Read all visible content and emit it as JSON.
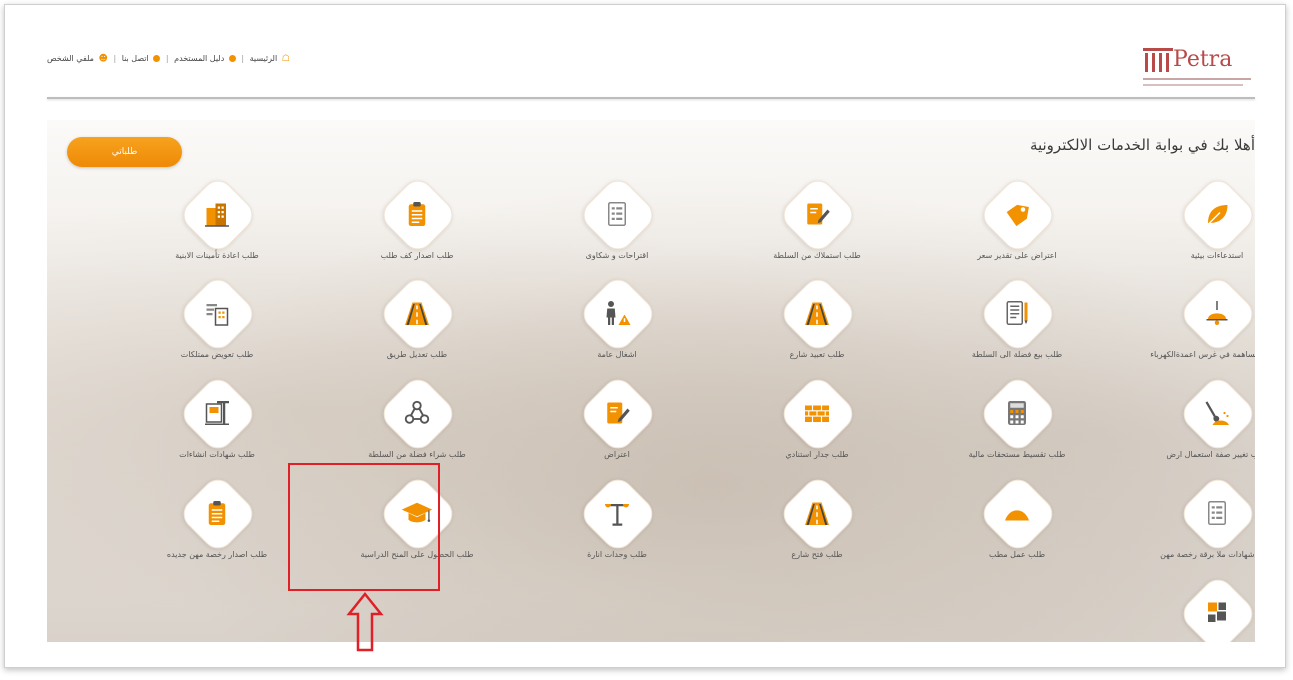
{
  "header": {
    "links": [
      {
        "label": "الرئيسية",
        "icon": "home-icon"
      },
      {
        "label": "دليل المستخدم",
        "icon": "info-icon"
      },
      {
        "label": "اتصل بنا",
        "icon": "info-icon"
      },
      {
        "label": "ملفي الشخص",
        "icon": "user-icon"
      }
    ],
    "logo_text": "Petra"
  },
  "main": {
    "welcome": "أهلا بك في بوابة الخدمات الالكترونية",
    "my_requests_button": "طلباتي"
  },
  "services": [
    {
      "label": "استدعاءات بيئية",
      "icon": "leaf-icon"
    },
    {
      "label": "اعتراض على تقدير سعر",
      "icon": "price-tag-icon"
    },
    {
      "label": "طلب استملاك من السلطة",
      "icon": "edit-document-icon"
    },
    {
      "label": "اقتراحات و شكاوى",
      "icon": "document-list-icon"
    },
    {
      "label": "طلب اصدار كف طلب",
      "icon": "clipboard-icon"
    },
    {
      "label": "طلب اعادة تأمينات الابنية",
      "icon": "buildings-icon"
    },
    {
      "label": "طلب المساهمة في غرس اعمدةالكهرباء",
      "icon": "lamp-icon"
    },
    {
      "label": "طلب بيع فضلة الى السلطة",
      "icon": "form-pen-icon"
    },
    {
      "label": "طلب تعبيد شارع",
      "icon": "road-icon"
    },
    {
      "label": "اشغال عامة",
      "icon": "worker-icon"
    },
    {
      "label": "طلب تعديل طريق",
      "icon": "road-icon"
    },
    {
      "label": "طلب تعويض ممتلكات",
      "icon": "property-icon"
    },
    {
      "label": "طلب تغيير صفة استعمال ارض",
      "icon": "shovel-icon"
    },
    {
      "label": "طلب تقسيط مستحقات مالية",
      "icon": "calculator-icon"
    },
    {
      "label": "طلب جدار استنادي",
      "icon": "brick-wall-icon"
    },
    {
      "label": "اعتراض",
      "icon": "edit-document-icon"
    },
    {
      "label": "طلب شراء فضلة من السلطة",
      "icon": "network-icon"
    },
    {
      "label": "طلب شهادات انشاءات",
      "icon": "construction-icon"
    },
    {
      "label": "طلب شهادات ملا برقة رخصة مهن",
      "icon": "document-list-icon"
    },
    {
      "label": "طلب عمل مطب",
      "icon": "speed-bump-icon"
    },
    {
      "label": "طلب فتح شارع",
      "icon": "road-icon"
    },
    {
      "label": "طلب وحدات انارة",
      "icon": "street-light-icon"
    },
    {
      "label": "طلب الحصول على المنح الدراسية",
      "icon": "graduation-cap-icon"
    },
    {
      "label": "طلب اصدار رخصة مهن جديده",
      "icon": "clipboard-icon"
    },
    {
      "label": "",
      "icon": "puzzle-icon"
    }
  ],
  "colors": {
    "accent": "#f39200",
    "highlight": "#e01f26",
    "logo": "#b84a4a"
  }
}
